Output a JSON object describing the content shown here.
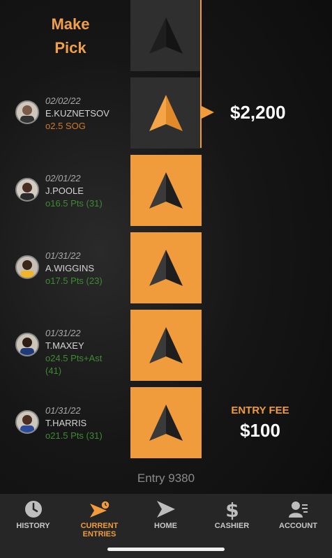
{
  "header": {
    "make_pick": "Make Pick"
  },
  "prize": "$2,200",
  "picks": [
    {
      "date": "02/02/22",
      "player": "E.KUZNETSOV",
      "stat": "o2.5 SOG",
      "status": "pending"
    },
    {
      "date": "02/01/22",
      "player": "J.POOLE",
      "stat": "o16.5 Pts (31)",
      "status": "won"
    },
    {
      "date": "01/31/22",
      "player": "A.WIGGINS",
      "stat": "o17.5 Pts (23)",
      "status": "won"
    },
    {
      "date": "01/31/22",
      "player": "T.MAXEY",
      "stat_line1": "o24.5 Pts+Ast",
      "stat_line2": "(41)",
      "status": "won"
    },
    {
      "date": "01/31/22",
      "player": "T.HARRIS",
      "stat": "o21.5 Pts (31)",
      "status": "won"
    }
  ],
  "entry_fee": {
    "label": "ENTRY FEE",
    "amount": "$100"
  },
  "entry_number": "Entry 9380",
  "tabs": [
    {
      "label": "HISTORY",
      "icon": "clock-icon"
    },
    {
      "label": "CURRENT ENTRIES",
      "icon": "entries-arrow-icon",
      "active": true
    },
    {
      "label": "HOME",
      "icon": "home-arrow-icon"
    },
    {
      "label": "CASHIER",
      "icon": "dollar-icon"
    },
    {
      "label": "ACCOUNT",
      "icon": "account-icon"
    }
  ],
  "colors": {
    "accent": "#f09c3c",
    "won": "#3d8c32",
    "pending": "#d07a2a",
    "tile_dark": "#2f2f2f"
  }
}
